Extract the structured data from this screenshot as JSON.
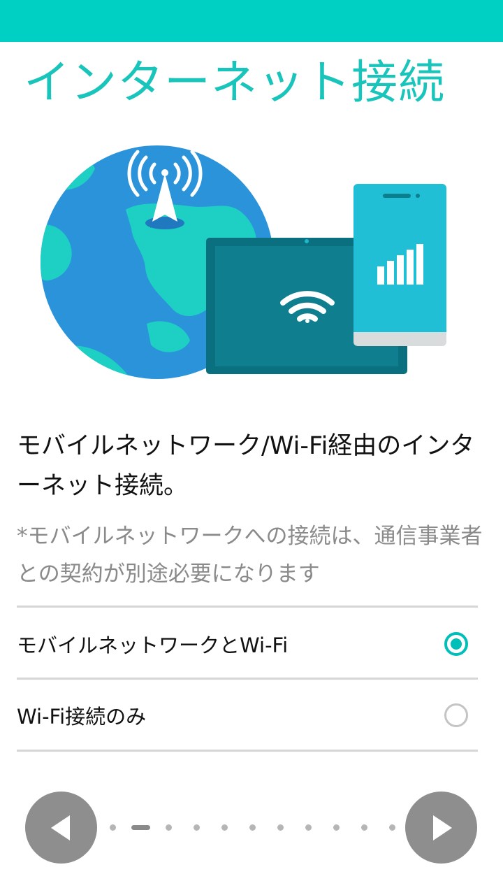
{
  "colors": {
    "accent": "#00bfb8",
    "status_bar": "#00d0c4",
    "title": "#19c4bb",
    "nav_button": "#8e8e8e"
  },
  "header": {
    "title": "インターネット接続"
  },
  "illustration": {
    "icons": [
      "globe-icon",
      "antenna-icon",
      "tablet-icon",
      "wifi-icon",
      "phone-icon",
      "signal-bars-icon"
    ]
  },
  "content": {
    "description": "モバイルネットワーク/Wi-Fi経由のインターネット接続。",
    "note": "*モバイルネットワークへの接続は、通信事業者との契約が別途必要になります"
  },
  "options": [
    {
      "label": "モバイルネットワークとWi-Fi",
      "selected": true
    },
    {
      "label": "Wi-Fi接続のみ",
      "selected": false
    }
  ],
  "pager": {
    "total": 11,
    "current": 2
  },
  "nav": {
    "prev_icon": "triangle-left-icon",
    "next_icon": "triangle-right-icon"
  }
}
